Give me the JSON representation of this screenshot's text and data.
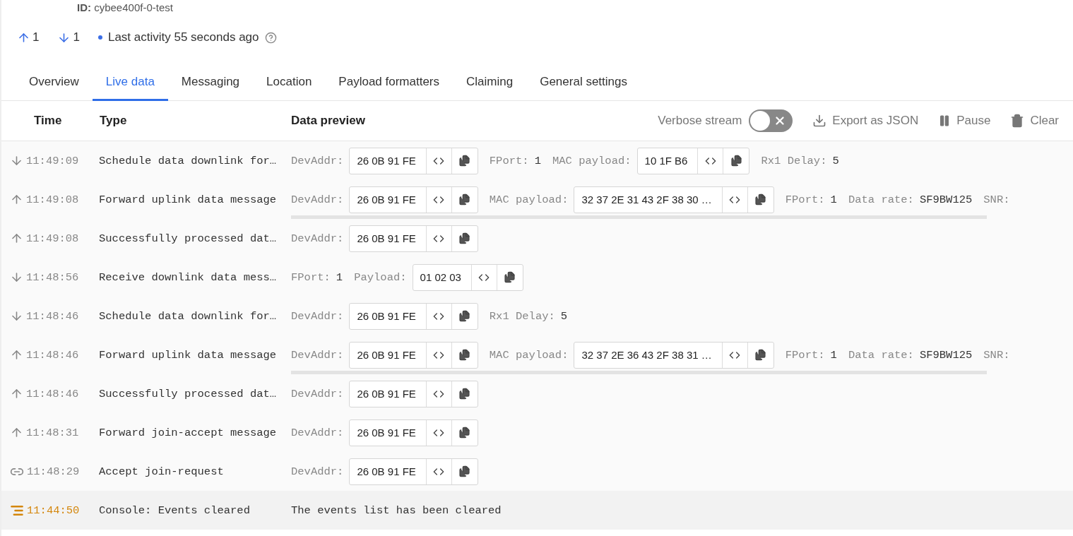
{
  "device": {
    "id_label": "ID:",
    "id_value": "cybee400f-0-test"
  },
  "counters": [
    {
      "kind": "up",
      "value": "1"
    },
    {
      "kind": "down",
      "value": "1"
    }
  ],
  "activity": {
    "text": "Last activity 55 seconds ago"
  },
  "tabs": [
    {
      "label": "Overview",
      "selected": false
    },
    {
      "label": "Live data",
      "selected": true
    },
    {
      "label": "Messaging",
      "selected": false
    },
    {
      "label": "Location",
      "selected": false
    },
    {
      "label": "Payload formatters",
      "selected": false
    },
    {
      "label": "Claiming",
      "selected": false
    },
    {
      "label": "General settings",
      "selected": false
    }
  ],
  "table": {
    "columns": [
      "Time",
      "Type",
      "Data preview"
    ],
    "toolbar": {
      "verbose_label": "Verbose stream",
      "verbose_on": false,
      "export": "Export as JSON",
      "pause": "Pause",
      "clear": "Clear"
    },
    "rows": [
      {
        "kind": "down",
        "time": "11:49:09",
        "type": "Schedule data downlink for…",
        "scrollable": false,
        "fields": [
          {
            "kind": "chip",
            "label": "DevAddr:",
            "value": "26 0B 91 FE"
          },
          {
            "kind": "text",
            "label": "FPort:",
            "value": "1"
          },
          {
            "kind": "chip",
            "label": "MAC payload:",
            "value": "10 1F B6"
          },
          {
            "kind": "text",
            "label": "Rx1 Delay:",
            "value": "5"
          }
        ]
      },
      {
        "kind": "up",
        "time": "11:49:08",
        "type": "Forward uplink data message",
        "scrollable": true,
        "fields": [
          {
            "kind": "chip",
            "label": "DevAddr:",
            "value": "26 0B 91 FE"
          },
          {
            "kind": "chip",
            "label": "MAC payload:",
            "value": "32 37 2E 31 43 2F 38 30 …"
          },
          {
            "kind": "text",
            "label": "FPort:",
            "value": "1"
          },
          {
            "kind": "text",
            "label": "Data rate:",
            "value": "SF9BW125"
          },
          {
            "kind": "text",
            "label": "SNR:"
          }
        ]
      },
      {
        "kind": "up",
        "time": "11:49:08",
        "type": "Successfully processed dat…",
        "scrollable": false,
        "fields": [
          {
            "kind": "chip",
            "label": "DevAddr:",
            "value": "26 0B 91 FE"
          }
        ]
      },
      {
        "kind": "down",
        "time": "11:48:56",
        "type": "Receive downlink data mess…",
        "scrollable": false,
        "fields": [
          {
            "kind": "text",
            "label": "FPort:",
            "value": "1"
          },
          {
            "kind": "chip",
            "label": "Payload:",
            "value": "01 02 03"
          }
        ]
      },
      {
        "kind": "down",
        "time": "11:48:46",
        "type": "Schedule data downlink for…",
        "scrollable": false,
        "fields": [
          {
            "kind": "chip",
            "label": "DevAddr:",
            "value": "26 0B 91 FE"
          },
          {
            "kind": "text",
            "label": "Rx1 Delay:",
            "value": "5"
          }
        ]
      },
      {
        "kind": "up",
        "time": "11:48:46",
        "type": "Forward uplink data message",
        "scrollable": true,
        "fields": [
          {
            "kind": "chip",
            "label": "DevAddr:",
            "value": "26 0B 91 FE"
          },
          {
            "kind": "chip",
            "label": "MAC payload:",
            "value": "32 37 2E 36 43 2F 38 31 …"
          },
          {
            "kind": "text",
            "label": "FPort:",
            "value": "1"
          },
          {
            "kind": "text",
            "label": "Data rate:",
            "value": "SF9BW125"
          },
          {
            "kind": "text",
            "label": "SNR:"
          }
        ]
      },
      {
        "kind": "up",
        "time": "11:48:46",
        "type": "Successfully processed dat…",
        "scrollable": false,
        "fields": [
          {
            "kind": "chip",
            "label": "DevAddr:",
            "value": "26 0B 91 FE"
          }
        ]
      },
      {
        "kind": "up",
        "time": "11:48:31",
        "type": "Forward join-accept message",
        "scrollable": false,
        "fields": [
          {
            "kind": "chip",
            "label": "DevAddr:",
            "value": "26 0B 91 FE"
          }
        ]
      },
      {
        "kind": "join",
        "time": "11:48:29",
        "type": "Accept join-request",
        "scrollable": false,
        "fields": [
          {
            "kind": "chip",
            "label": "DevAddr:",
            "value": "26 0B 91 FE"
          }
        ]
      },
      {
        "kind": "console",
        "time": "11:44:50",
        "type": "Console: Events cleared",
        "scrollable": false,
        "fields": [
          {
            "kind": "message",
            "value": "The events list has been cleared"
          }
        ]
      }
    ]
  }
}
